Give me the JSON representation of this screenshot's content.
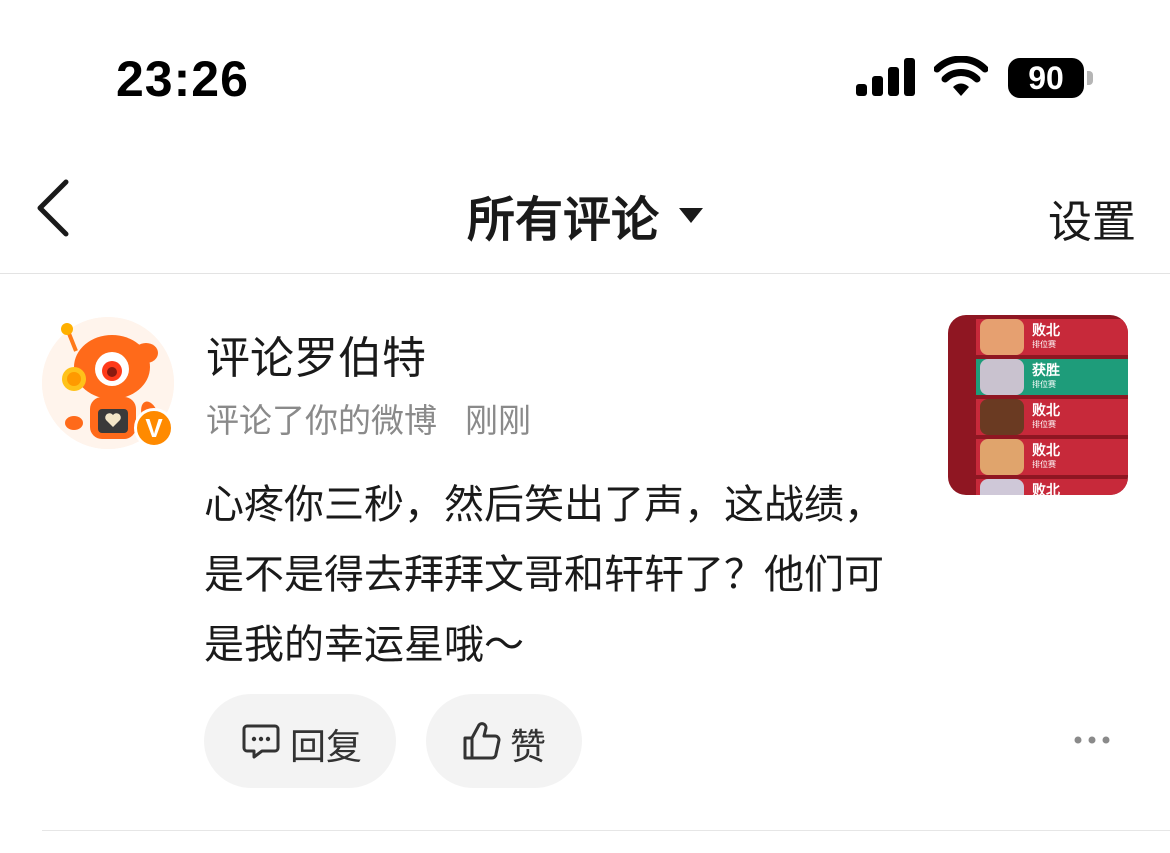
{
  "status_bar": {
    "time": "23:26",
    "battery": "90"
  },
  "nav": {
    "title": "所有评论",
    "settings_label": "设置"
  },
  "comment": {
    "user_name": "评论罗伯特",
    "verified_mark": "V",
    "action_text": "评论了你的微博",
    "time_ago": "刚刚",
    "text": "心疼你三秒，然后笑出了声，这战绩，是不是得去拜拜文哥和轩轩了？他们可是我的幸运星哦～",
    "reply_label": "回复",
    "like_label": "赞"
  },
  "thumbnail": {
    "rows": [
      {
        "result": "败北",
        "sub": "排位赛",
        "status": "loss"
      },
      {
        "result": "获胜",
        "sub": "排位赛",
        "status": "win"
      },
      {
        "result": "败北",
        "sub": "排位赛",
        "status": "loss"
      },
      {
        "result": "败北",
        "sub": "排位赛",
        "status": "loss"
      },
      {
        "result": "败北",
        "sub": "",
        "status": "loss"
      }
    ]
  },
  "colors": {
    "accent": "#ff8a00",
    "loss": "#c7293a",
    "win": "#1e9c7a"
  }
}
